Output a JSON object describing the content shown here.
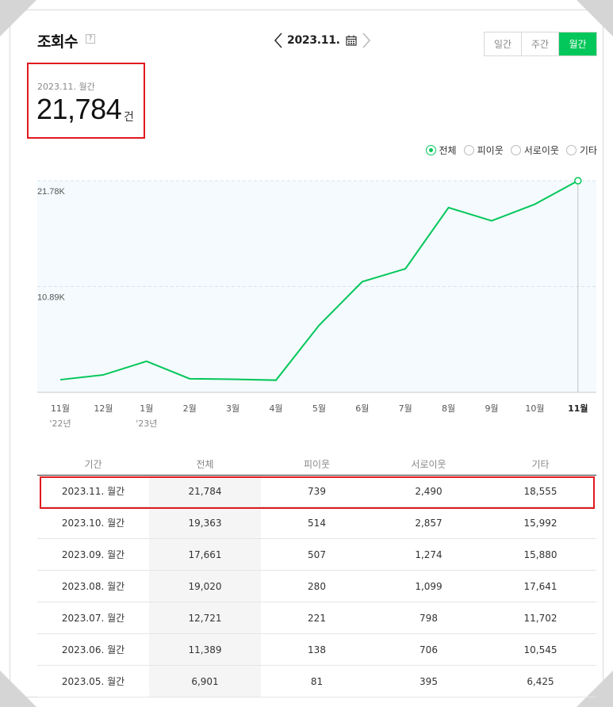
{
  "header": {
    "title": "조회수",
    "help_glyph": "?",
    "date_label": "2023.11.",
    "period_tabs": [
      {
        "label": "일간",
        "active": false
      },
      {
        "label": "주간",
        "active": false
      },
      {
        "label": "월간",
        "active": true
      }
    ]
  },
  "summary": {
    "period": "2023.11. 월간",
    "value": "21,784",
    "unit": "건"
  },
  "legend": [
    {
      "label": "전체",
      "selected": true
    },
    {
      "label": "피이웃",
      "selected": false
    },
    {
      "label": "서로이웃",
      "selected": false
    },
    {
      "label": "기타",
      "selected": false
    }
  ],
  "colors": {
    "accent": "#03c75a",
    "highlight": "#e0191f",
    "chart_fill": "#f4fafd"
  },
  "chart_data": {
    "type": "line",
    "categories": [
      "11월",
      "12월",
      "1월",
      "2월",
      "3월",
      "4월",
      "5월",
      "6월",
      "7월",
      "8월",
      "9월",
      "10월",
      "11월"
    ],
    "year_labels": [
      {
        "index": 0,
        "label": "'22년"
      },
      {
        "index": 2,
        "label": "'23년"
      }
    ],
    "series": [
      {
        "values": [
          1300,
          1800,
          3200,
          1400,
          1350,
          1250,
          6901,
          11389,
          12721,
          19020,
          17661,
          19363,
          21784
        ]
      }
    ],
    "ytick_labels": [
      "21.78K",
      "10.89K"
    ],
    "yticks": [
      21784,
      10892
    ],
    "ylim": [
      0,
      21784
    ],
    "grid": true,
    "highlight_index": 12
  },
  "table": {
    "columns": [
      "기간",
      "전체",
      "피이웃",
      "서로이웃",
      "기타"
    ],
    "rows": [
      [
        "2023.11. 월간",
        "21,784",
        "739",
        "2,490",
        "18,555"
      ],
      [
        "2023.10. 월간",
        "19,363",
        "514",
        "2,857",
        "15,992"
      ],
      [
        "2023.09. 월간",
        "17,661",
        "507",
        "1,274",
        "15,880"
      ],
      [
        "2023.08. 월간",
        "19,020",
        "280",
        "1,099",
        "17,641"
      ],
      [
        "2023.07. 월간",
        "12,721",
        "221",
        "798",
        "11,702"
      ],
      [
        "2023.06. 월간",
        "11,389",
        "138",
        "706",
        "10,545"
      ],
      [
        "2023.05. 월간",
        "6,901",
        "81",
        "395",
        "6,425"
      ]
    ]
  }
}
